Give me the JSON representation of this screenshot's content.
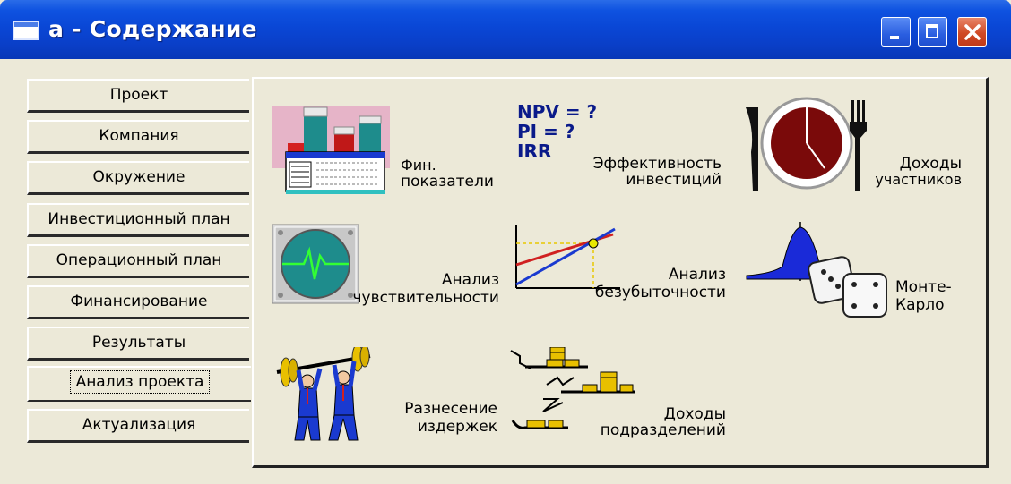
{
  "window": {
    "title": "a - Содержание"
  },
  "tabs": [
    {
      "label": "Проект"
    },
    {
      "label": "Компания"
    },
    {
      "label": "Окружение"
    },
    {
      "label": "Инвестиционный план"
    },
    {
      "label": "Операционный план"
    },
    {
      "label": "Финансирование"
    },
    {
      "label": "Результаты"
    },
    {
      "label": "Анализ проекта",
      "selected": true
    },
    {
      "label": "Актуализация"
    }
  ],
  "items": {
    "fin": {
      "line1": "Фин.",
      "line2": "показатели"
    },
    "eff": {
      "line1": "Эффективность",
      "line2": "инвестиций",
      "npv": "NPV = ?",
      "pi": "PI = ?",
      "irr": "IRR"
    },
    "income": {
      "line1": "Доходы",
      "line2": "участников"
    },
    "sens": {
      "line1": "Анализ",
      "line2": "чувствительности"
    },
    "breakeven": {
      "line1": "Анализ",
      "line2": "безубыточности"
    },
    "monte": {
      "line1": "Монте-",
      "line2": "Карло"
    },
    "costs": {
      "line1": "Разнесение",
      "line2": "издержек"
    },
    "depts": {
      "line1": "Доходы",
      "line2": "подразделений"
    }
  },
  "colors": {
    "title_bar": "#0a47d6",
    "face": "#ece9d8",
    "npv_text": "#0a1a8a"
  }
}
